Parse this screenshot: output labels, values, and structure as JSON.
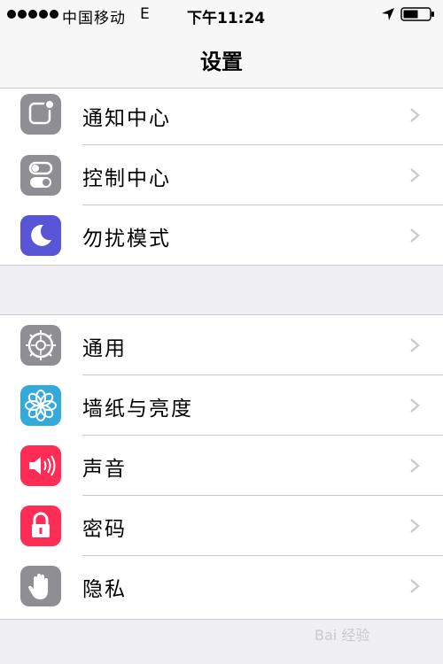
{
  "status_bar": {
    "carrier": "中国移动",
    "network": "E",
    "time": "下午11:24"
  },
  "nav": {
    "title": "设置"
  },
  "groups": [
    {
      "items": [
        {
          "label": "通知中心",
          "icon": "notification-center-icon",
          "color": "#8e8e93"
        },
        {
          "label": "控制中心",
          "icon": "control-center-icon",
          "color": "#8e8e93"
        },
        {
          "label": "勿扰模式",
          "icon": "do-not-disturb-icon",
          "color": "#5856d6"
        }
      ]
    },
    {
      "items": [
        {
          "label": "通用",
          "icon": "gear-icon",
          "color": "#8e8e93"
        },
        {
          "label": "墙纸与亮度",
          "icon": "flower-icon",
          "color": "#34aadc"
        },
        {
          "label": "声音",
          "icon": "speaker-icon",
          "color": "#ff2d55"
        },
        {
          "label": "密码",
          "icon": "lock-icon",
          "color": "#ff2d55"
        },
        {
          "label": "隐私",
          "icon": "hand-icon",
          "color": "#8e8e93"
        }
      ]
    }
  ],
  "watermark": {
    "text": "Bai 经验"
  }
}
